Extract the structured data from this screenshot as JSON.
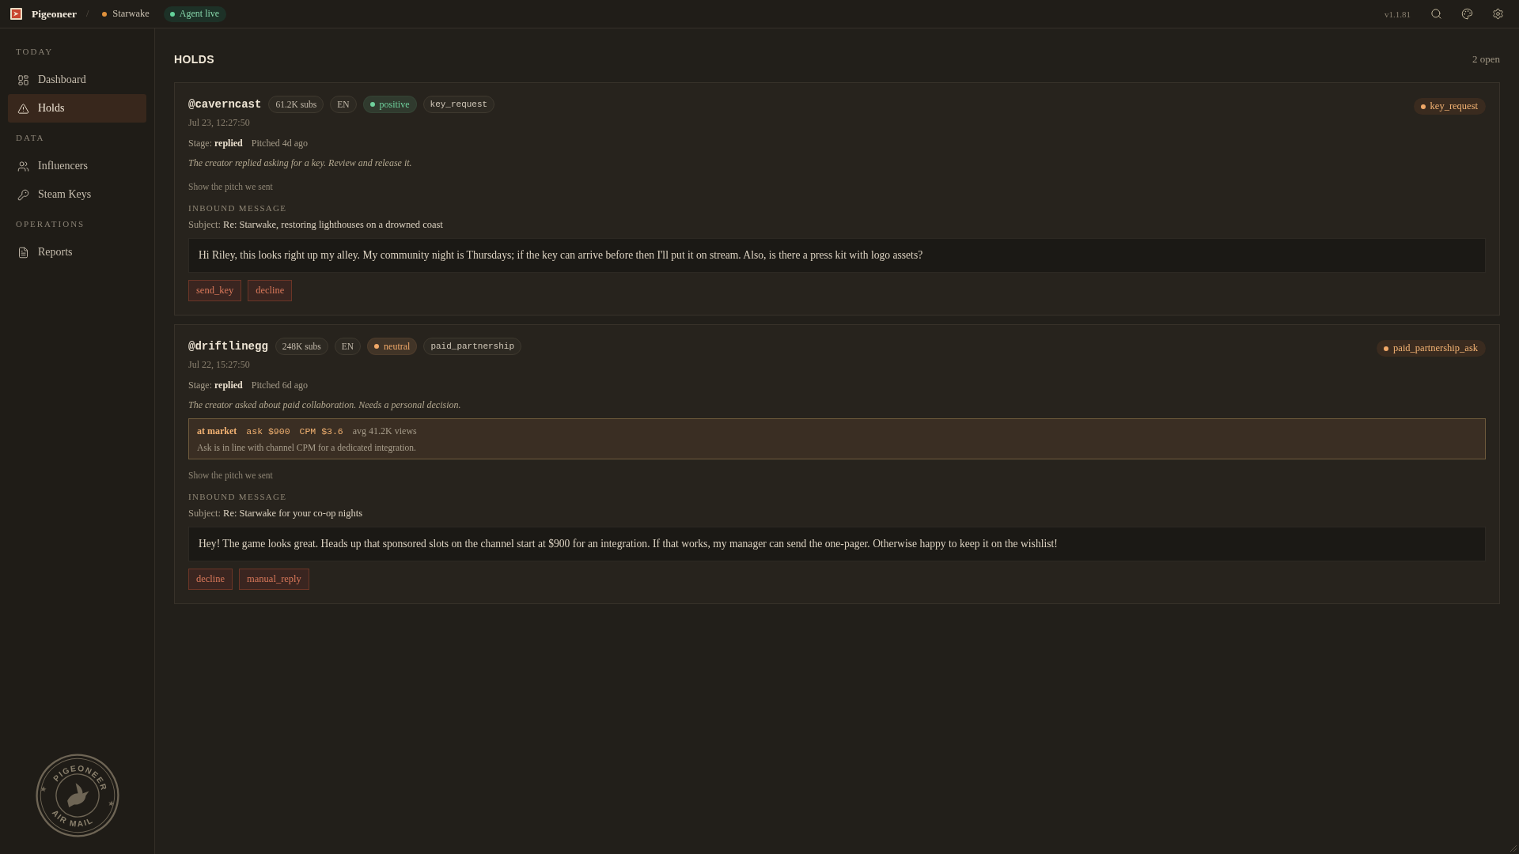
{
  "topbar": {
    "brand": "Pigeoneer",
    "separator": "/",
    "project": "Starwake",
    "status": "Agent live",
    "version": "v1.1.81"
  },
  "sidebar": {
    "sections": [
      {
        "title": "TODAY",
        "items": [
          {
            "label": "Dashboard",
            "selected": false
          },
          {
            "label": "Holds",
            "selected": true
          }
        ]
      },
      {
        "title": "DATA",
        "items": [
          {
            "label": "Influencers",
            "selected": false
          },
          {
            "label": "Steam Keys",
            "selected": false
          }
        ]
      },
      {
        "title": "OPERATIONS",
        "items": [
          {
            "label": "Reports",
            "selected": false
          }
        ]
      }
    ],
    "stamp": {
      "top_text": "PIGEONEER",
      "bottom_text": "AIR MAIL"
    }
  },
  "page": {
    "title": "HOLDS",
    "count": "2 open"
  },
  "holds": [
    {
      "handle": "@caverncast",
      "tags": [
        {
          "kind": "plain",
          "label": "61.2K subs"
        },
        {
          "kind": "plain",
          "label": "EN"
        },
        {
          "kind": "sentiment",
          "label": "positive",
          "color": "#6fd09c"
        },
        {
          "kind": "code",
          "label": "key_request"
        }
      ],
      "reason": "key_request",
      "date": "Jul 23, 12:27:50",
      "stage": "Stage: **replied**",
      "pitched": "Pitched 4d ago",
      "note": "The creator replied asking for a key. Review and release it.",
      "pitch_toggle": "Show the pitch we sent",
      "inbound_label": "INBOUND MESSAGE",
      "subject_label": "Subject:",
      "subject": "Re: Starwake, restoring lighthouses on a drowned coast",
      "message": "Hi Riley, this looks right up my alley. My community night is Thursdays; if the key can arrive before then I'll put it on stream. Also, is there a press kit with logo assets?",
      "actions": [
        "send_key",
        "decline"
      ]
    },
    {
      "handle": "@driftlinegg",
      "tags": [
        {
          "kind": "plain",
          "label": "248K subs"
        },
        {
          "kind": "plain",
          "label": "EN"
        },
        {
          "kind": "sentiment",
          "label": "neutral",
          "color": "#f0a868"
        },
        {
          "kind": "code",
          "label": "paid_partnership"
        }
      ],
      "reason": "paid_partnership_ask",
      "date": "Jul 22, 15:27:50",
      "stage": "Stage: **replied**",
      "pitched": "Pitched 6d ago",
      "note": "The creator asked about paid collaboration. Needs a personal decision.",
      "market": {
        "verdict": "at market",
        "ask": "ask $900",
        "cpm": "CPM $3.6",
        "views": "avg 41.2K views",
        "note": "Ask is in line with channel CPM for a dedicated integration."
      },
      "pitch_toggle": "Show the pitch we sent",
      "inbound_label": "INBOUND MESSAGE",
      "subject_label": "Subject:",
      "subject": "Re: Starwake for your co-op nights",
      "message": "Hey! The game looks great. Heads up that sponsored slots on the channel start at $900 for an integration. If that works, my manager can send the one-pager. Otherwise happy to keep it on the wishlist!",
      "actions": [
        "decline",
        "manual_reply"
      ]
    }
  ]
}
